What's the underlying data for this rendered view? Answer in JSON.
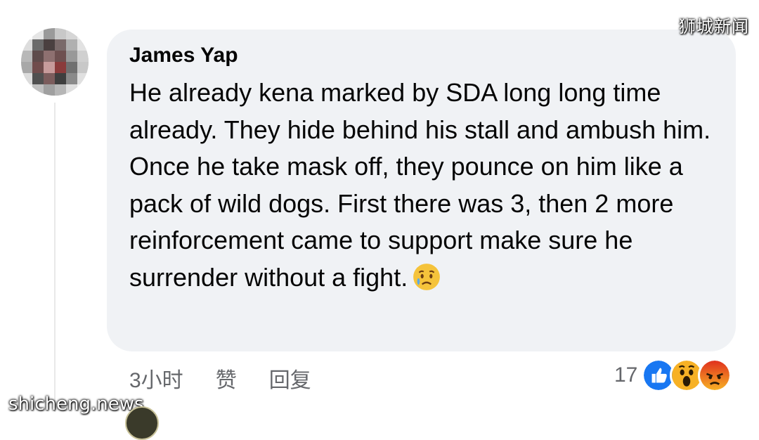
{
  "watermarks": {
    "top_right": "狮城新闻",
    "bottom_left": "shicheng.news"
  },
  "comment": {
    "author": "James Yap",
    "text": "He already kena marked by SDA long long time already. They hide behind his stall and ambush him. Once he take mask off, they pounce on him like a pack of wild dogs. First there was 3, then 2 more reinforcement came to support make sure he surrender without a fight.",
    "emoji": "sad-tear-emoji",
    "time": "3小时",
    "like_label": "赞",
    "reply_label": "回复",
    "reaction_count": "17",
    "reactions": [
      "like-icon",
      "wow-icon",
      "angry-icon"
    ]
  },
  "colors": {
    "bubble": "#f0f2f5",
    "meta_text": "#65676b",
    "like_blue": "#1877f2",
    "wow_yellow": "#f7b125",
    "angry_orange": "#e9710f"
  }
}
